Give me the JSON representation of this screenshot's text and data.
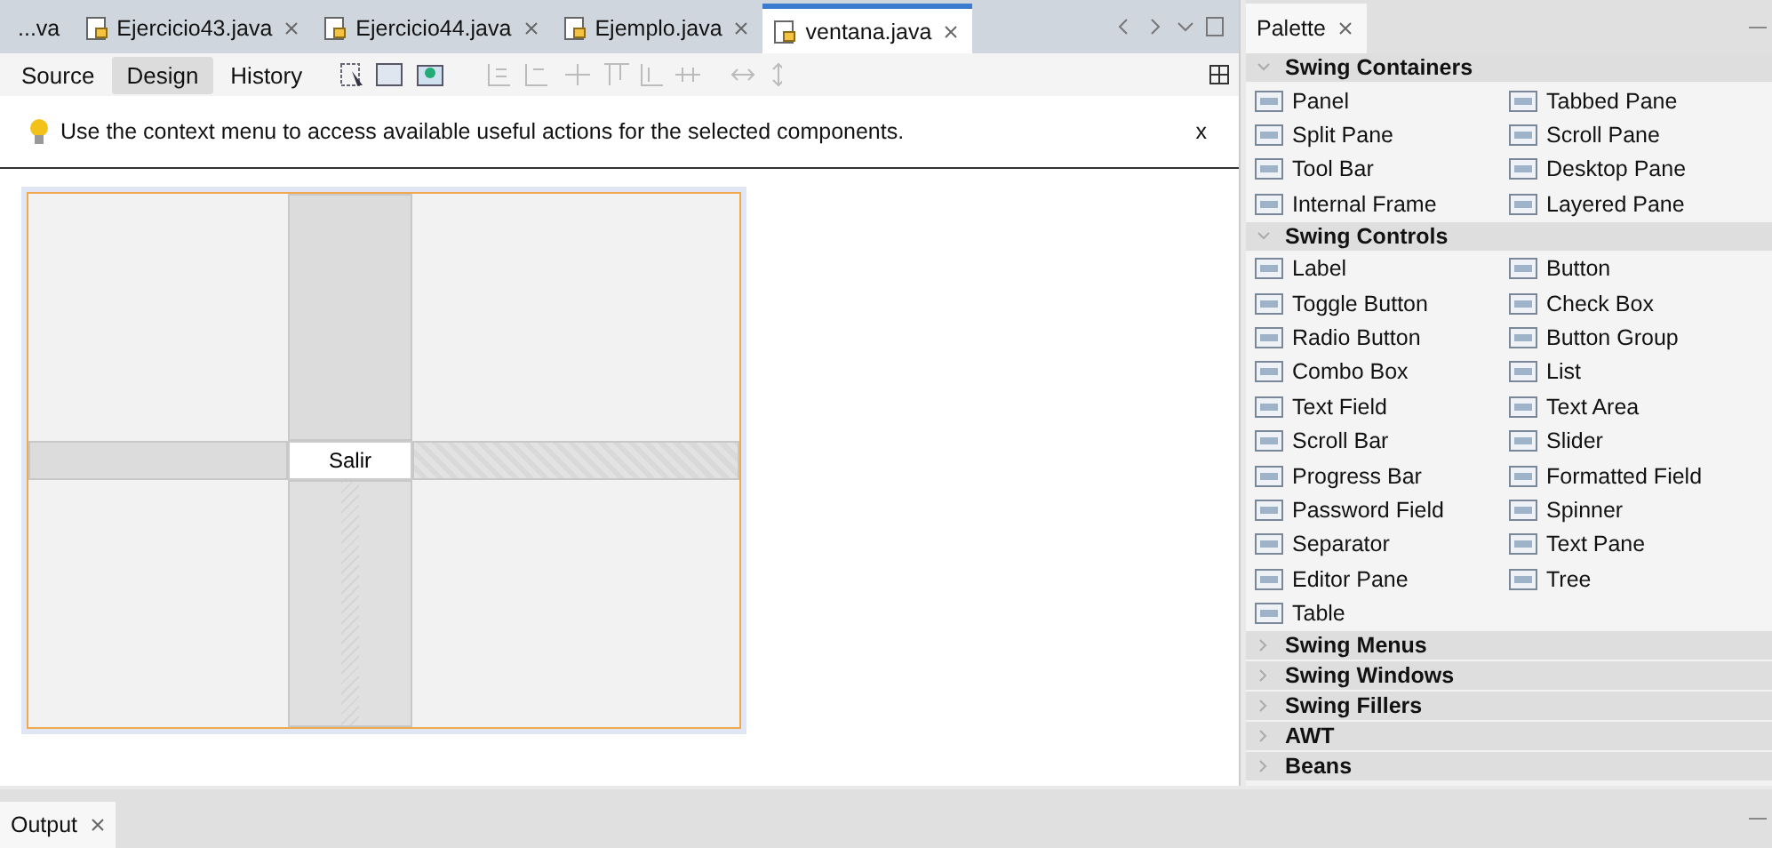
{
  "editor_tabs": [
    {
      "label": "...va",
      "selected": false,
      "icon": false
    },
    {
      "label": "Ejercicio43.java",
      "selected": false,
      "icon": true
    },
    {
      "label": "Ejercicio44.java",
      "selected": false,
      "icon": true
    },
    {
      "label": "Ejemplo.java",
      "selected": false,
      "icon": true
    },
    {
      "label": "ventana.java",
      "selected": true,
      "icon": true
    }
  ],
  "view_buttons": [
    {
      "label": "Source",
      "selected": false
    },
    {
      "label": "Design",
      "selected": true
    },
    {
      "label": "History",
      "selected": false
    }
  ],
  "info_bar": {
    "message": "Use the context menu to access available useful actions for the selected components.",
    "close": "x"
  },
  "form": {
    "button": "Salir"
  },
  "palette": {
    "title": "Palette",
    "categories": [
      {
        "name": "Swing Containers",
        "expanded": true,
        "items": [
          "Panel",
          "Tabbed Pane",
          "Split Pane",
          "Scroll Pane",
          "Tool Bar",
          "Desktop Pane",
          "Internal Frame",
          "Layered Pane"
        ]
      },
      {
        "name": "Swing Controls",
        "expanded": true,
        "items": [
          "Label",
          "Button",
          "Toggle Button",
          "Check Box",
          "Radio Button",
          "Button Group",
          "Combo Box",
          "List",
          "Text Field",
          "Text Area",
          "Scroll Bar",
          "Slider",
          "Progress Bar",
          "Formatted Field",
          "Password Field",
          "Spinner",
          "Separator",
          "Text Pane",
          "Editor Pane",
          "Tree",
          "Table"
        ]
      },
      {
        "name": "Swing Menus",
        "expanded": false
      },
      {
        "name": "Swing Windows",
        "expanded": false
      },
      {
        "name": "Swing Fillers",
        "expanded": false
      },
      {
        "name": "AWT",
        "expanded": false
      },
      {
        "name": "Beans",
        "expanded": false
      }
    ]
  },
  "output_tab": {
    "label": "Output"
  }
}
